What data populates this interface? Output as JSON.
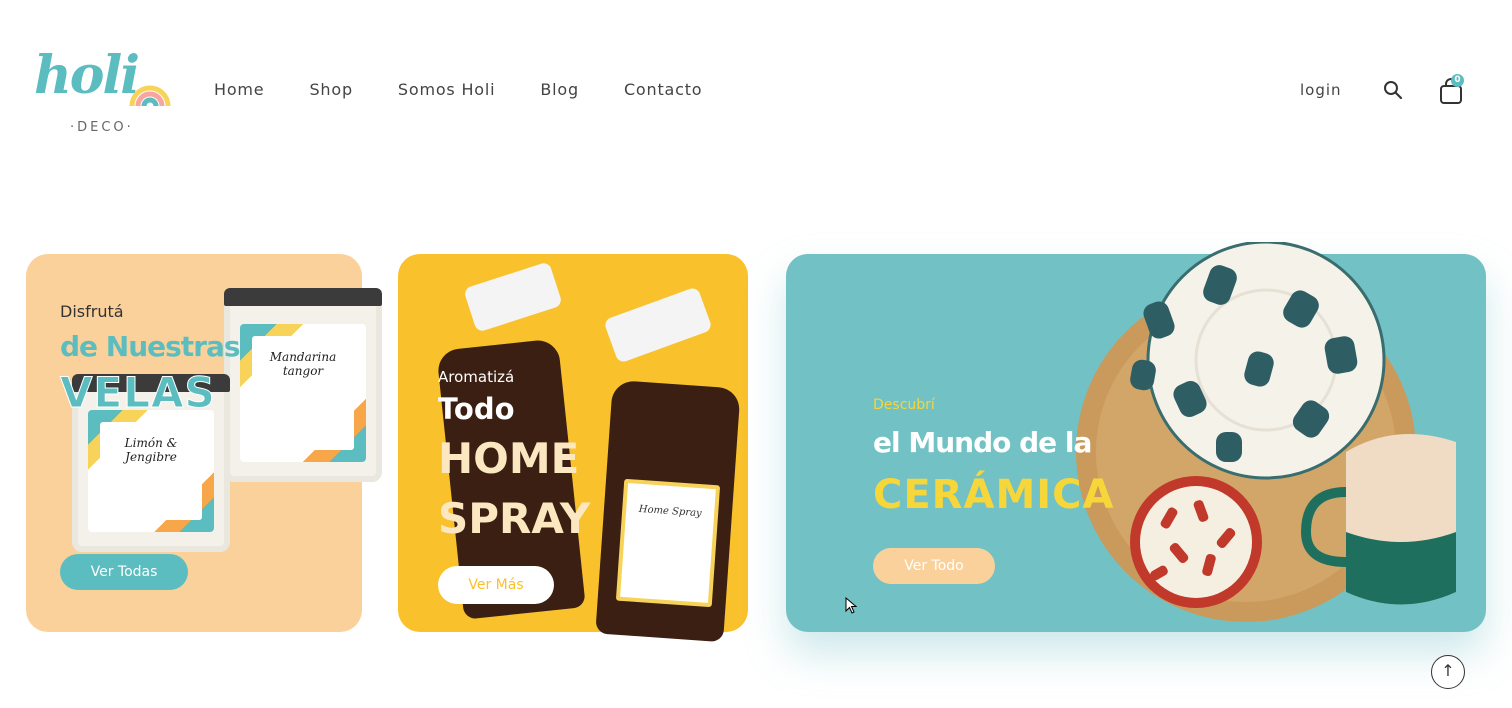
{
  "brand": {
    "name": "holi",
    "sub": "·DECO·"
  },
  "nav": {
    "items": [
      "Home",
      "Shop",
      "Somos Holi",
      "Blog",
      "Contacto"
    ],
    "login": "login",
    "cart_count": "0"
  },
  "cards": {
    "velas": {
      "pre": "Disfrutá",
      "line1": "de Nuestras",
      "line2": "VELAS",
      "button": "Ver Todas",
      "jar1_label": "Mandarina tangor",
      "jar2_label": "Limón & Jengibre"
    },
    "spray": {
      "pre": "Aromatizá",
      "line1": "Todo",
      "line2": "HOME",
      "line3": "SPRAY",
      "button": "Ver Más",
      "bottle_label": "Home Spray"
    },
    "ceramica": {
      "pre": "Descubrí",
      "line1": "el Mundo de la",
      "line2": "CERÁMICA",
      "button": "Ver Todo"
    }
  },
  "colors": {
    "teal": "#72c1c5",
    "peach": "#fbd19b",
    "yellow": "#f9c12c",
    "accent_yellow": "#f7d63a"
  },
  "icons": [
    "search-icon",
    "cart-icon",
    "arrow-up-icon",
    "mouse-pointer-icon"
  ]
}
